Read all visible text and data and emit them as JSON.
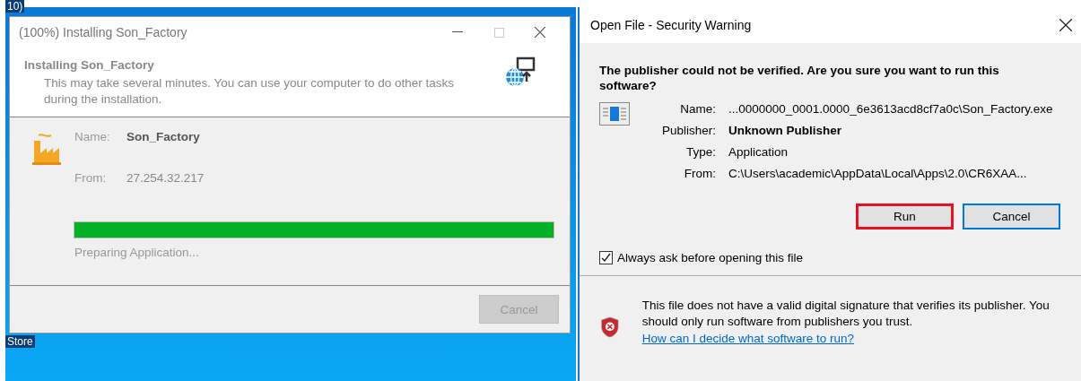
{
  "desktop": {
    "labels": [
      "10)",
      "Store"
    ]
  },
  "installer": {
    "title": "(100%) Installing Son_Factory",
    "heading": "Installing Son_Factory",
    "description": "This may take several minutes. You can use your computer to do other tasks during the installation.",
    "fields": [
      {
        "label": "Name:",
        "value": "Son_Factory",
        "bold": true
      },
      {
        "label": "From:",
        "value": "27.254.32.217",
        "bold": false
      }
    ],
    "progress": {
      "level": 1
    },
    "status": "Preparing Application...",
    "cancel": {
      "label": "Cancel",
      "disabled": true
    }
  },
  "security_dialog": {
    "title": "Open File - Security Warning",
    "question": "The publisher could not be verified.  Are you sure you want to run this software?",
    "fields": [
      {
        "label": "Name:",
        "value": "...0000000_0001.0000_6e3613acd8cf7a0c\\Son_Factory.exe",
        "bold": false
      },
      {
        "label": "Publisher:",
        "value": "Unknown Publisher",
        "bold": true
      },
      {
        "label": "Type:",
        "value": "Application",
        "bold": false
      },
      {
        "label": "From:",
        "value": "C:\\Users\\academic\\AppData\\Local\\Apps\\2.0\\CR6XAA...",
        "bold": false
      }
    ],
    "buttons": [
      {
        "label": "Run",
        "highlighted": true,
        "focused": false
      },
      {
        "label": "Cancel",
        "highlighted": false,
        "focused": true
      }
    ],
    "checkbox": {
      "label": "Always ask before opening this file",
      "checked": true
    },
    "warning": "This file does not have a valid digital signature that verifies its publisher.  You should only run software from publishers you trust.",
    "link": "How can I decide what software to run?"
  }
}
